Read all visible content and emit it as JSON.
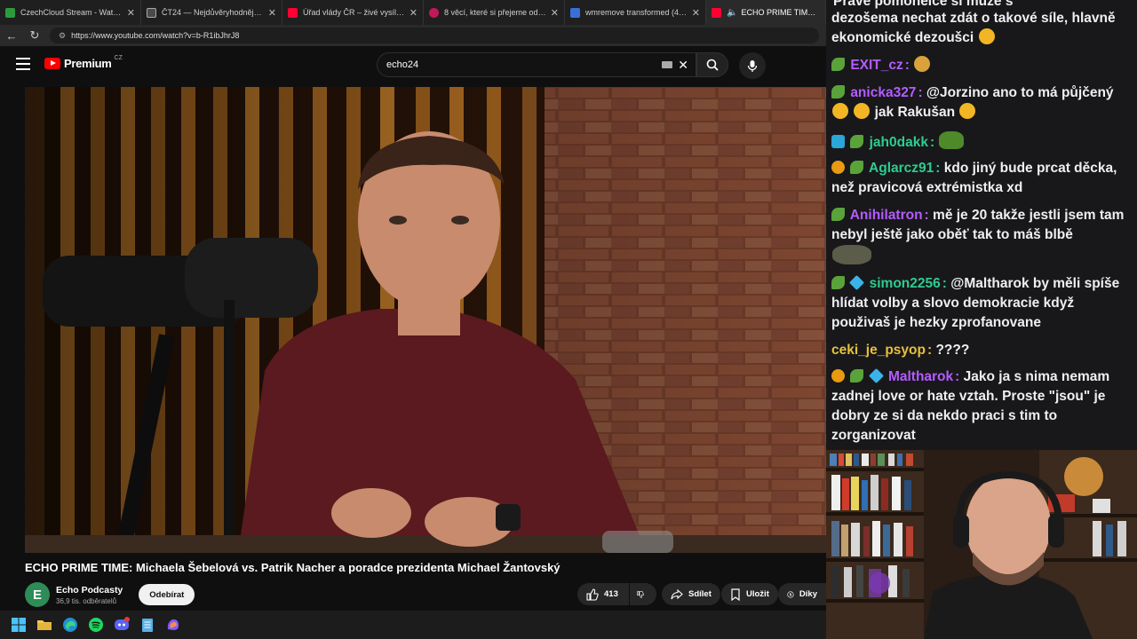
{
  "browser": {
    "tabs": [
      {
        "label": "CzechCloud Stream - Watch Live o",
        "favicon_color": "#2b9a3d",
        "active": false
      },
      {
        "label": "ČT24 — Nejdůvěryhodnější zprav",
        "favicon_color": "#4a4a4a",
        "active": false
      },
      {
        "label": "Úřad vlády ČR – živé vysílání - You",
        "favicon_color": "#ff0033",
        "active": false
      },
      {
        "label": "8 věcí, které si přejeme od DLC pr",
        "favicon_color": "#c2185b",
        "active": false
      },
      {
        "label": "wmremove transformed (4) — Po",
        "favicon_color": "#3b6fd8",
        "active": false
      },
      {
        "label": "ECHO PRIME TIME: Micha",
        "favicon_color": "#ff0033",
        "active": true
      }
    ],
    "url": "https://www.youtube.com/watch?v=b-R1ibJhrJ8"
  },
  "youtube": {
    "logo_text": "Premium",
    "country_code": "CZ",
    "search_value": "echo24",
    "video_title": "ECHO PRIME TIME: Michaela Šebelová vs. Patrik Nacher a poradce prezidenta Michael Žantovský",
    "channel": {
      "avatar_letter": "E",
      "name": "Echo Podcasty",
      "subscribers": "36,9 tis. odběratelů",
      "subscribe_label": "Odebírat"
    },
    "actions": {
      "like_count": "413",
      "share_label": "Sdílet",
      "save_label": "Uložit",
      "thanks_label": "Díky"
    }
  },
  "chat": {
    "messages": [
      {
        "user": "",
        "text": "Právě pomohelce si může s",
        "color": "#efeff1",
        "badges": []
      },
      {
        "user": "",
        "text": "dezošema nechat zdát o takové síle, hlavně ekonomické dezoušci",
        "color": "#efeff1",
        "badges": []
      },
      {
        "user": "EXIT_cz",
        "text": "",
        "color": "#b55cff",
        "badges": [
          "green"
        ]
      },
      {
        "user": "anicka327",
        "text": "@Jorzino ano to má půjčený",
        "text2": "jak Rakušan",
        "color": "#b55cff",
        "badges": [
          "green"
        ]
      },
      {
        "user": "jah0dakk",
        "text": "",
        "color": "#2ecc8f",
        "badges": [
          "blue",
          "green"
        ]
      },
      {
        "user": "Aglarcz91",
        "text": "kdo jiný bude prcat děcka, než pravicová extrémistka xd",
        "color": "#2ecc8f",
        "badges": [
          "orange",
          "green"
        ]
      },
      {
        "user": "Anihilatron",
        "text": "mě je 20 takže jestli jsem tam nebyl ještě jako oběť tak to máš blbě",
        "color": "#b55cff",
        "badges": [
          "green"
        ]
      },
      {
        "user": "simon2256",
        "text": "@Maltharok by měli spíše hlídat volby a slovo demokracie když použivaš je hezky zprofanovane",
        "color": "#2ecc8f",
        "badges": [
          "green",
          "cube"
        ]
      },
      {
        "user": "ceki_je_psyop",
        "text": "????",
        "color": "#e7c03b",
        "badges": []
      },
      {
        "user": "Maltharok",
        "text": "Jako ja s nima nemam zadnej love or hate vztah. Proste \"jsou\" je dobry ze si da nekdo praci s tim to zorganizovat",
        "color": "#b55cff",
        "badges": [
          "orange",
          "green",
          "cube"
        ]
      }
    ]
  },
  "colors": {
    "accent_red": "#ff0000",
    "chat_bg": "#18181b",
    "page_bg": "#0f0f0f"
  }
}
